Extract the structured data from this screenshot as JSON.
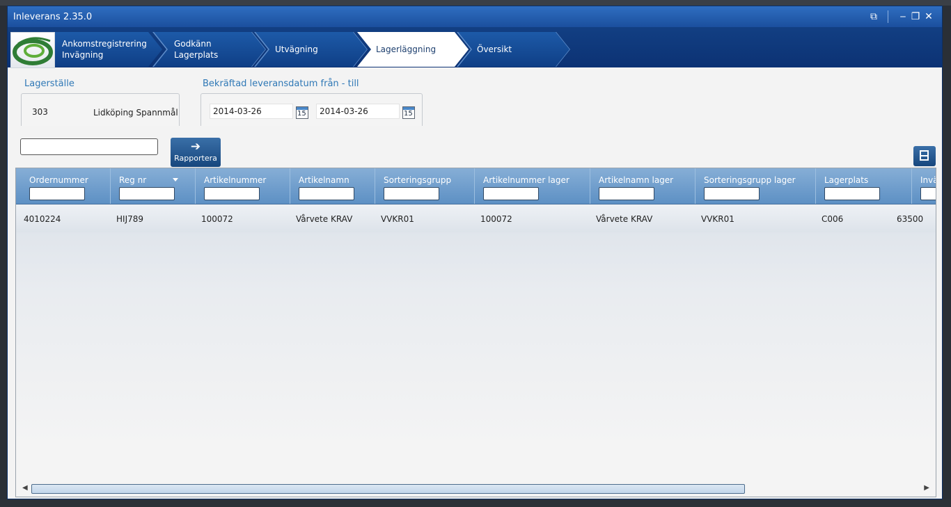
{
  "window": {
    "title": "Inleverans 2.35.0"
  },
  "title_controls": {
    "popout": "⧉",
    "minimize": "‒",
    "maximize": "❐",
    "close": "✕"
  },
  "wizard": {
    "steps": [
      {
        "label": "Ankomstregistrering\nInvägning"
      },
      {
        "label": "Godkänn\nLagerplats"
      },
      {
        "label": "Utvägning"
      },
      {
        "label": "Lagerläggning"
      },
      {
        "label": "Översikt"
      }
    ],
    "active_step": "Lagerläggning"
  },
  "lagerstalle": {
    "label": "Lagerställe",
    "code": "303",
    "name": "Lidköping Spannmål"
  },
  "date_filter": {
    "label": "Bekräftad leveransdatum från - till",
    "from": "2014-03-26",
    "to": "2014-03-26",
    "calendar_day": "15"
  },
  "search": {
    "value": ""
  },
  "report_button": {
    "label": "Rapportera"
  },
  "grid": {
    "columns": [
      {
        "label": "Ordernummer"
      },
      {
        "label": "Reg nr"
      },
      {
        "label": "Artikelnummer"
      },
      {
        "label": "Artikelnamn"
      },
      {
        "label": "Sorteringsgrupp"
      },
      {
        "label": "Artikelnummer lager"
      },
      {
        "label": "Artikelnamn lager"
      },
      {
        "label": "Sorteringsgrupp lager"
      },
      {
        "label": "Lagerplats"
      },
      {
        "label": "Invä"
      }
    ],
    "rows": [
      [
        "4010224",
        "HIJ789",
        "100072",
        "Vårvete KRAV",
        "VVKR01",
        "100072",
        "Vårvete KRAV",
        "VVKR01",
        "C006",
        "63500"
      ]
    ]
  },
  "scrollbar": {
    "left": "◀",
    "right": "▶"
  }
}
